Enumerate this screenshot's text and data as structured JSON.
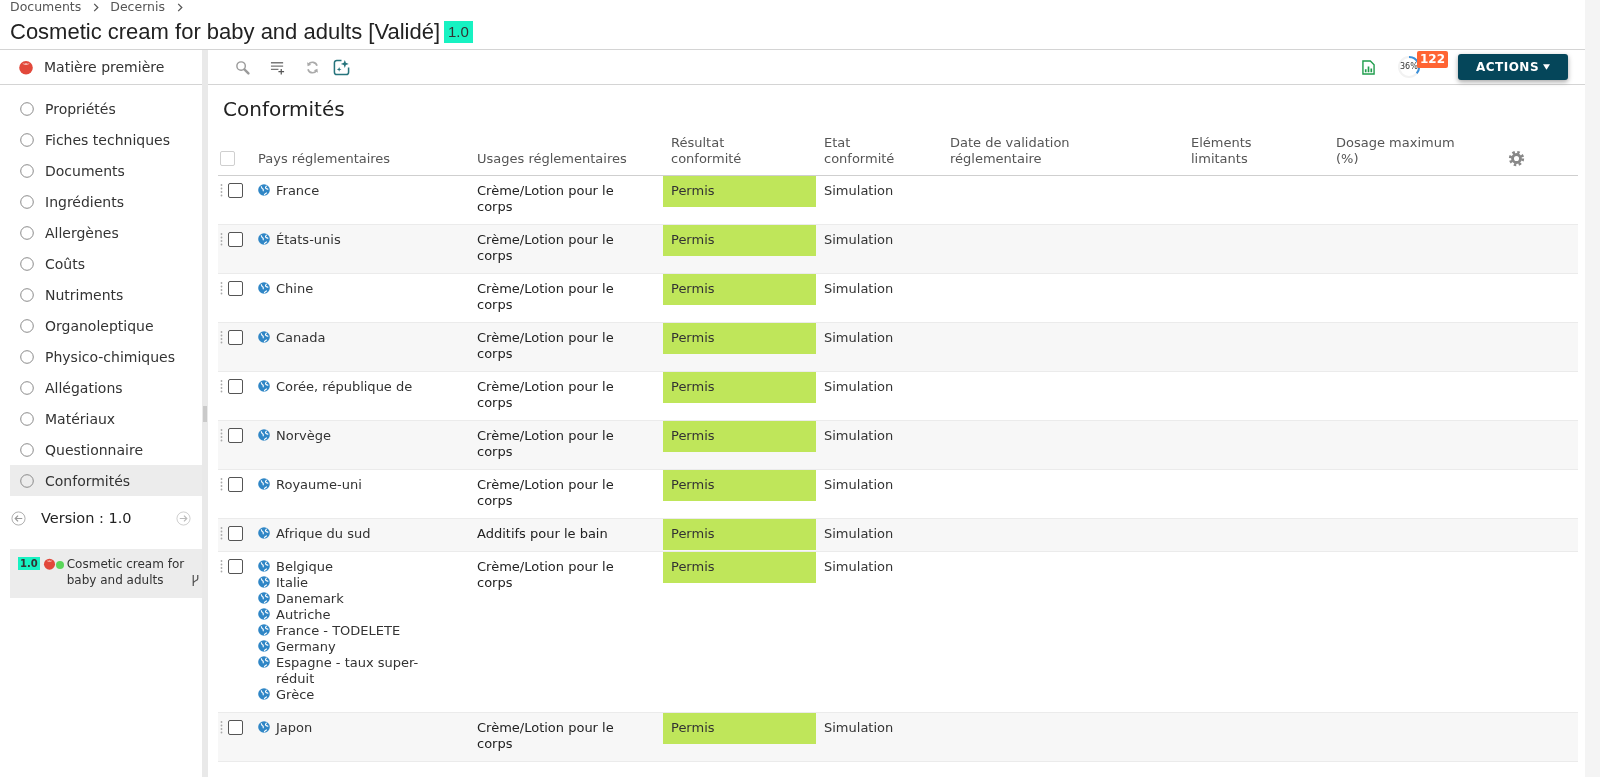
{
  "breadcrumb": [
    {
      "label": "Documents"
    },
    {
      "label": "Decernis"
    }
  ],
  "title": {
    "text": "Cosmetic cream for baby and adults [Validé]",
    "version": "1.0"
  },
  "sidebar": {
    "header": "Matière première",
    "items": [
      {
        "label": "Propriétés",
        "selected": false
      },
      {
        "label": "Fiches techniques",
        "selected": false
      },
      {
        "label": "Documents",
        "selected": false
      },
      {
        "label": "Ingrédients",
        "selected": false
      },
      {
        "label": "Allergènes",
        "selected": false
      },
      {
        "label": "Coûts",
        "selected": false
      },
      {
        "label": "Nutriments",
        "selected": false
      },
      {
        "label": "Organoleptique",
        "selected": false
      },
      {
        "label": "Physico-chimiques",
        "selected": false
      },
      {
        "label": "Allégations",
        "selected": false
      },
      {
        "label": "Matériaux",
        "selected": false
      },
      {
        "label": "Questionnaire",
        "selected": false
      },
      {
        "label": "Conformités",
        "selected": true
      }
    ],
    "version": {
      "label": "Version : 1.0",
      "item_version": "1.0",
      "item_name": "Cosmetic cream for baby and adults"
    }
  },
  "toolbar": {
    "progress": {
      "label": "36%",
      "level": 0.36
    },
    "badge": "122",
    "actions": "ACTIONS"
  },
  "section_title": "Conformités",
  "table": {
    "select_all_checked": false,
    "columns": [
      "Pays réglementaires",
      "Usages réglementaires",
      "Résultat conformité",
      "Etat conformité",
      "Date de validation réglementaire",
      "Eléments limitants",
      "Dosage maximum (%)"
    ],
    "rows": [
      {
        "checked": false,
        "countries": [
          "France"
        ],
        "usage": "Crème/Lotion pour le corps",
        "result": "Permis",
        "status": "Simulation"
      },
      {
        "checked": false,
        "countries": [
          "États-unis"
        ],
        "usage": "Crème/Lotion pour le corps",
        "result": "Permis",
        "status": "Simulation"
      },
      {
        "checked": false,
        "countries": [
          "Chine"
        ],
        "usage": "Crème/Lotion pour le corps",
        "result": "Permis",
        "status": "Simulation"
      },
      {
        "checked": false,
        "countries": [
          "Canada"
        ],
        "usage": "Crème/Lotion pour le corps",
        "result": "Permis",
        "status": "Simulation"
      },
      {
        "checked": false,
        "countries": [
          "Corée, république de"
        ],
        "usage": "Crème/Lotion pour le corps",
        "result": "Permis",
        "status": "Simulation"
      },
      {
        "checked": false,
        "countries": [
          "Norvège"
        ],
        "usage": "Crème/Lotion pour le corps",
        "result": "Permis",
        "status": "Simulation"
      },
      {
        "checked": false,
        "countries": [
          "Royaume-uni"
        ],
        "usage": "Crème/Lotion pour le corps",
        "result": "Permis",
        "status": "Simulation"
      },
      {
        "checked": false,
        "countries": [
          "Afrique du sud"
        ],
        "usage": "Additifs pour le bain",
        "result": "Permis",
        "status": "Simulation"
      },
      {
        "checked": false,
        "countries": [
          "Belgique",
          "Italie",
          "Danemark",
          "Autriche",
          "France - TODELETE",
          "Germany",
          "Espagne - taux super-réduit",
          "Grèce"
        ],
        "usage": "Crème/Lotion pour le corps",
        "result": "Permis",
        "status": "Simulation"
      },
      {
        "checked": false,
        "countries": [
          "Japon"
        ],
        "usage": "Crème/Lotion pour le corps",
        "result": "Permis",
        "status": "Simulation"
      }
    ]
  }
}
